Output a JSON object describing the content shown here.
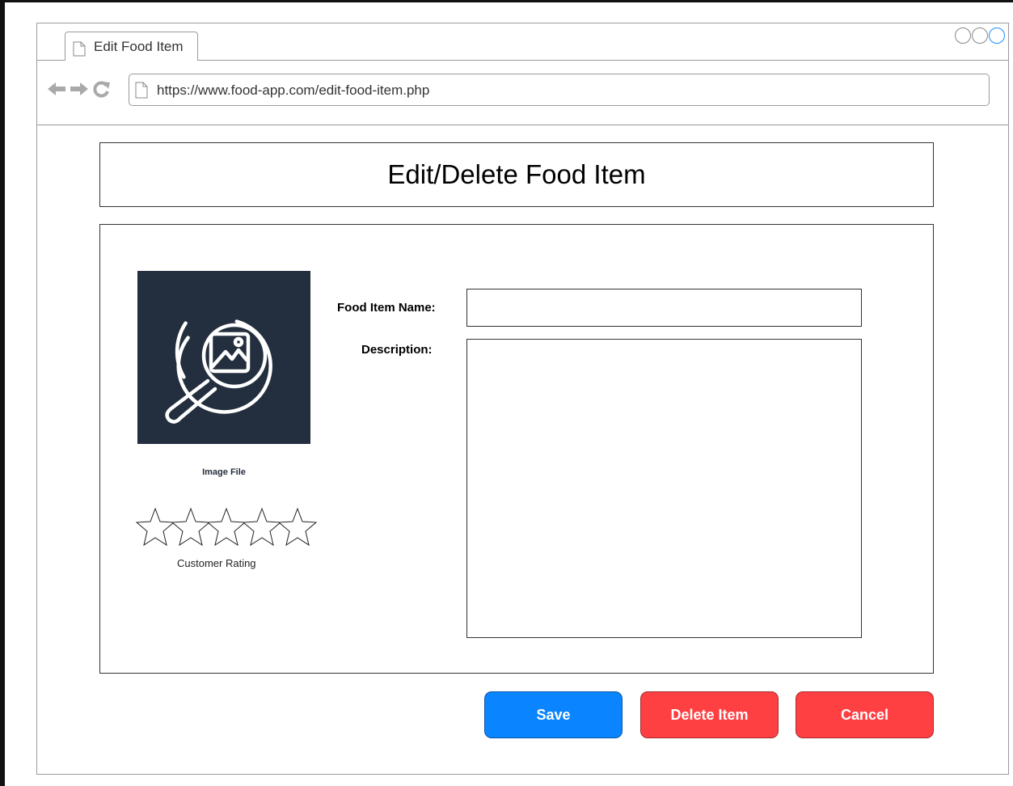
{
  "browser": {
    "tab_title": "Edit Food Item",
    "url": "https://www.food-app.com/edit-food-item.php"
  },
  "page": {
    "title": "Edit/Delete Food Item"
  },
  "form": {
    "image_label": "Image File",
    "rating_label": "Customer Rating",
    "rating_value": 0,
    "rating_max": 5,
    "name_label": "Food Item Name:",
    "name_value": "",
    "description_label": "Description:",
    "description_value": ""
  },
  "actions": {
    "save_label": "Save",
    "delete_label": "Delete Item",
    "cancel_label": "Cancel"
  },
  "colors": {
    "save": "#0a85ff",
    "delete": "#ff4043",
    "cancel": "#ff4043",
    "image_bg": "#232f3e"
  },
  "icons": {
    "image": "image-search-icon",
    "rating": "star-icon"
  }
}
